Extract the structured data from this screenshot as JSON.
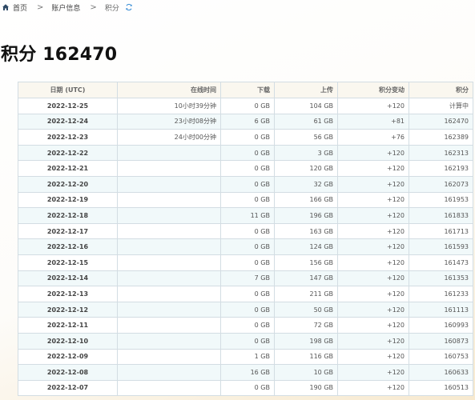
{
  "breadcrumb": {
    "home_icon": "home-icon",
    "home_label": "首页",
    "account_label": "账户信息",
    "current_label": "积分",
    "refresh_icon": "refresh-icon",
    "separator": ">"
  },
  "page": {
    "title": "积分 162470"
  },
  "table": {
    "columns": [
      "日期 (UTC)",
      "在线时间",
      "下载",
      "上传",
      "积分变动",
      "积分"
    ],
    "rows": [
      {
        "date": "2022-12-25",
        "online": "10小时39分钟",
        "download": "0 GB",
        "upload": "104 GB",
        "change": "+120",
        "points": "计算中"
      },
      {
        "date": "2022-12-24",
        "online": "23小时08分钟",
        "download": "6 GB",
        "upload": "61 GB",
        "change": "+81",
        "points": "162470"
      },
      {
        "date": "2022-12-23",
        "online": "24小时00分钟",
        "download": "0 GB",
        "upload": "56 GB",
        "change": "+76",
        "points": "162389"
      },
      {
        "date": "2022-12-22",
        "online": "",
        "download": "0 GB",
        "upload": "3 GB",
        "change": "+120",
        "points": "162313"
      },
      {
        "date": "2022-12-21",
        "online": "",
        "download": "0 GB",
        "upload": "120 GB",
        "change": "+120",
        "points": "162193"
      },
      {
        "date": "2022-12-20",
        "online": "",
        "download": "0 GB",
        "upload": "32 GB",
        "change": "+120",
        "points": "162073"
      },
      {
        "date": "2022-12-19",
        "online": "",
        "download": "0 GB",
        "upload": "166 GB",
        "change": "+120",
        "points": "161953"
      },
      {
        "date": "2022-12-18",
        "online": "",
        "download": "11 GB",
        "upload": "196 GB",
        "change": "+120",
        "points": "161833"
      },
      {
        "date": "2022-12-17",
        "online": "",
        "download": "0 GB",
        "upload": "163 GB",
        "change": "+120",
        "points": "161713"
      },
      {
        "date": "2022-12-16",
        "online": "",
        "download": "0 GB",
        "upload": "124 GB",
        "change": "+120",
        "points": "161593"
      },
      {
        "date": "2022-12-15",
        "online": "",
        "download": "0 GB",
        "upload": "156 GB",
        "change": "+120",
        "points": "161473"
      },
      {
        "date": "2022-12-14",
        "online": "",
        "download": "7 GB",
        "upload": "147 GB",
        "change": "+120",
        "points": "161353"
      },
      {
        "date": "2022-12-13",
        "online": "",
        "download": "0 GB",
        "upload": "211 GB",
        "change": "+120",
        "points": "161233"
      },
      {
        "date": "2022-12-12",
        "online": "",
        "download": "0 GB",
        "upload": "50 GB",
        "change": "+120",
        "points": "161113"
      },
      {
        "date": "2022-12-11",
        "online": "",
        "download": "0 GB",
        "upload": "72 GB",
        "change": "+120",
        "points": "160993"
      },
      {
        "date": "2022-12-10",
        "online": "",
        "download": "0 GB",
        "upload": "198 GB",
        "change": "+120",
        "points": "160873"
      },
      {
        "date": "2022-12-09",
        "online": "",
        "download": "1 GB",
        "upload": "116 GB",
        "change": "+120",
        "points": "160753"
      },
      {
        "date": "2022-12-08",
        "online": "",
        "download": "16 GB",
        "upload": "10 GB",
        "change": "+120",
        "points": "160633"
      },
      {
        "date": "2022-12-07",
        "online": "",
        "download": "0 GB",
        "upload": "190 GB",
        "change": "+120",
        "points": "160513"
      }
    ]
  },
  "colors": {
    "title": "#111111",
    "header_bg": "#faf7ef",
    "row_alt_bg": "#f1f9fa",
    "border": "#d3dde3",
    "refresh_icon": "#3d8fd6"
  }
}
